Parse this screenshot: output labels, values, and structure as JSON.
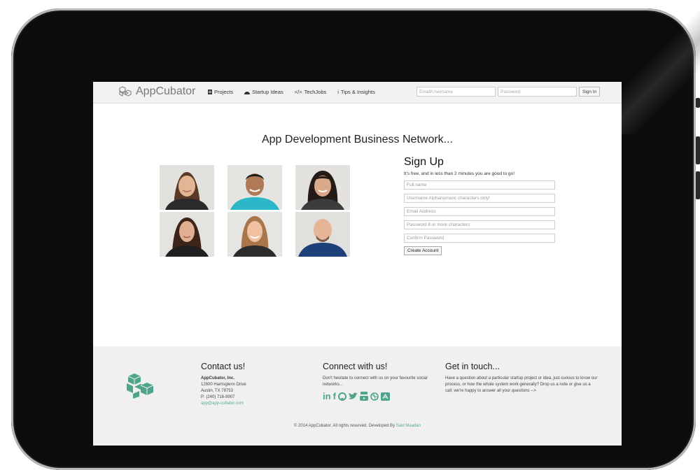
{
  "brand": {
    "name": "AppCubator"
  },
  "nav": {
    "items": [
      {
        "label": "Projects",
        "icon": "projects-icon"
      },
      {
        "label": "Startup Ideas",
        "icon": "dashboard-icon"
      },
      {
        "label": "TechJobs",
        "icon": "code-icon"
      },
      {
        "label": "Tips & Insights",
        "icon": "info-icon"
      }
    ],
    "code_glyph": "</>",
    "info_glyph": "i"
  },
  "login": {
    "email_placeholder": "Email/Username",
    "password_placeholder": "Password",
    "signin_label": "Sign In"
  },
  "hero": {
    "headline": "App Development Business Network..."
  },
  "signup": {
    "title": "Sign Up",
    "tagline": "It's free, and in less than 2 minutes you are good to go!",
    "fields": {
      "full_name": "Full name",
      "username": "Username Alphanumeric characters only!",
      "email": "Email Address",
      "password": "Password 8 or more characters",
      "confirm": "Confirm Password"
    },
    "submit_label": "Create Account"
  },
  "footer": {
    "contact": {
      "title": "Contact us!",
      "company": "AppCubator, Inc.",
      "street": "12800 Harrisglenn Drive",
      "city": "Austin, TX 78753",
      "phone": "P: (240) 716-9907",
      "email": "app@app-cubator.com"
    },
    "connect": {
      "title": "Connect with us!",
      "text": "Don't hesitate to connect with us on your favourite social networks...",
      "social": {
        "linkedin": "in",
        "facebook": "f"
      }
    },
    "touch": {
      "title": "Get in touch...",
      "text": "Have a question about a particular startup project or idea, just curious to know our process, or how the whole system work generally? Drop us a note or give us a call; we're happy to answer all your questions -->"
    },
    "copyright": "© 2014 AppCubator. All rights reserved. Developed By",
    "developer": "Said Maadan"
  },
  "colors": {
    "accent": "#4fa58c",
    "navbar": "#f2f2f2",
    "footer": "#f0f0f0"
  }
}
